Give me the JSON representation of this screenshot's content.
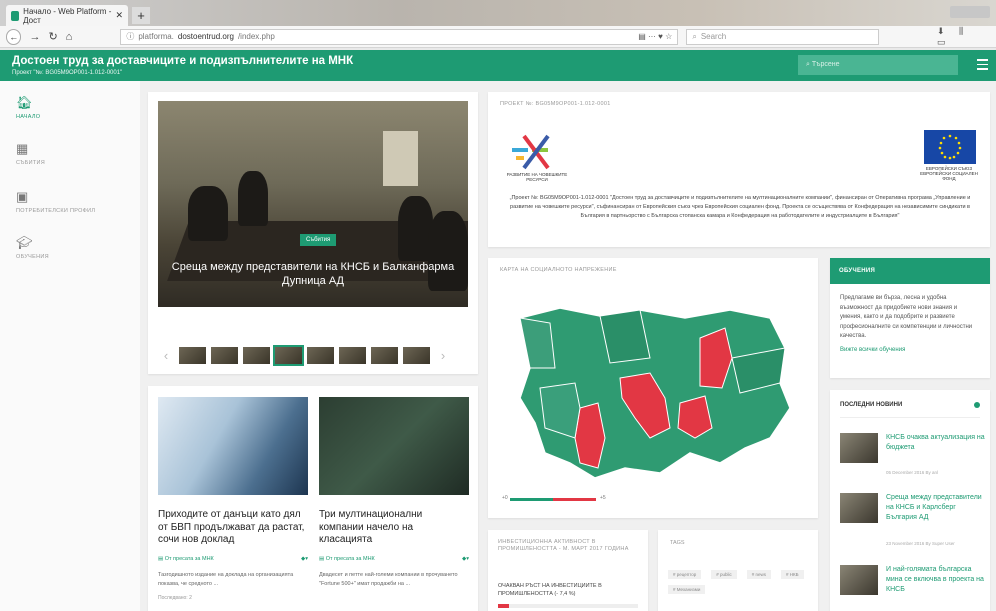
{
  "browser": {
    "tab_title": "Начало - Web Platform - Дост",
    "url_prefix": "platforma.",
    "url_domain": "dostoentrud.org",
    "url_path": "/index.php",
    "search_placeholder": "Search"
  },
  "site": {
    "title": "Достоен труд за доставчиците и подизпълнителите на МНК",
    "subtitle": "Проект \"№: BG05M9OP001-1.012-0001\"",
    "search_placeholder": "Търсене"
  },
  "sidebar": {
    "items": [
      {
        "label": "НАЧАЛО",
        "icon": "home-icon"
      },
      {
        "label": "СЪБИТИЯ",
        "icon": "calendar-icon"
      },
      {
        "label": "ПОТРЕБИТЕЛСКИ ПРОФИЛ",
        "icon": "profile-icon"
      },
      {
        "label": "ОБУЧЕНИЯ",
        "icon": "graduation-cap-icon"
      }
    ]
  },
  "slider": {
    "badge": "Събития",
    "caption": "Среща между представители на КНСБ и Балканфарма Дупница АД"
  },
  "project": {
    "title": "ПРОЕКТ №: BG05M9OP001-1.012-0001",
    "logo_left_text": "РАЗВИТИЕ НА ЧОВЕШКИТЕ РЕСУРСИ",
    "logo_right_text": "ЕВРОПЕЙСКИ СЪЮЗ ЕВРОПЕЙСКИ СОЦИАЛЕН ФОНД",
    "text": "„Проект №: BG05M9OP001-1.012-0001 \"Достоен труд за доставчиците и подизпълнителите на мултинационалните компании\", финансиран от Оперативна програма „Управление и развитие на човешките ресурси\", съфинансиран от Европейския съюз чрез Европейския социален фонд. Проекта се осъществява от Конфедерация на независимите синдикати в България в партньорство с Българска стопанска камара и Конфедерация на работодателите и индустриалците в България\""
  },
  "map": {
    "title": "КАРТА НА СОЦИАЛНОТО НАПРЕЖЕНИЕ",
    "legend_min": "+0",
    "legend_max": "+5",
    "colors": {
      "low": "#2f9b72",
      "high": "#e23744"
    }
  },
  "training": {
    "title": "ОБУЧЕНИЯ",
    "body": "Предлагаме ви бърза, лесна и удобна възможност да придобиете нови знания и умения, както и да подобрите и развиете професионалните си компетенции и личностни качества.",
    "link": "Вижте всички обучения"
  },
  "news": {
    "title": "ПОСЛЕДНИ НОВИНИ",
    "items": [
      {
        "title": "КНСБ очаква актуализация на бюджета",
        "date": "05 December 2016 By anl"
      },
      {
        "title": "Среща между представители на КНСБ и Карлсберг България АД",
        "date": "23 November 2016 By Super User"
      },
      {
        "title": "И най-голямата българска мина се включва в проекта на КНСБ",
        "date": ""
      }
    ]
  },
  "articles": [
    {
      "title": "Приходите от данъци като дял от БВП продължават да растат, сочи нов доклад",
      "category": "От пресата за МНК",
      "excerpt": "Тазгодишното издание на доклада на организацията показва, че средното ...",
      "more": "Последвано: 2"
    },
    {
      "title": "Три мултинационални компании начело на класацията",
      "category": "От пресата за МНК",
      "excerpt": "Двадесет и петте най-големи компании в прочуването \"Fortune 500+\" имат продажби на ...",
      "more": ""
    }
  ],
  "investment": {
    "title": "ИНВЕСТИЦИОННА АКТИВНОСТ В ПРОМИШЛЕНОСТТА - М. МАРТ 2017 ГОДИНА",
    "subtitle": "ОЧАКВАН РЪСТ НА ИНВЕСТИЦИИТЕ В ПРОМИШЛЕНОСТТА (- 7,4 %)",
    "progress": 0.08
  },
  "tags": {
    "title": "TAGS",
    "items": [
      "# рецептор",
      "# public",
      "# news",
      "# НКБ",
      "# Механизми"
    ]
  }
}
